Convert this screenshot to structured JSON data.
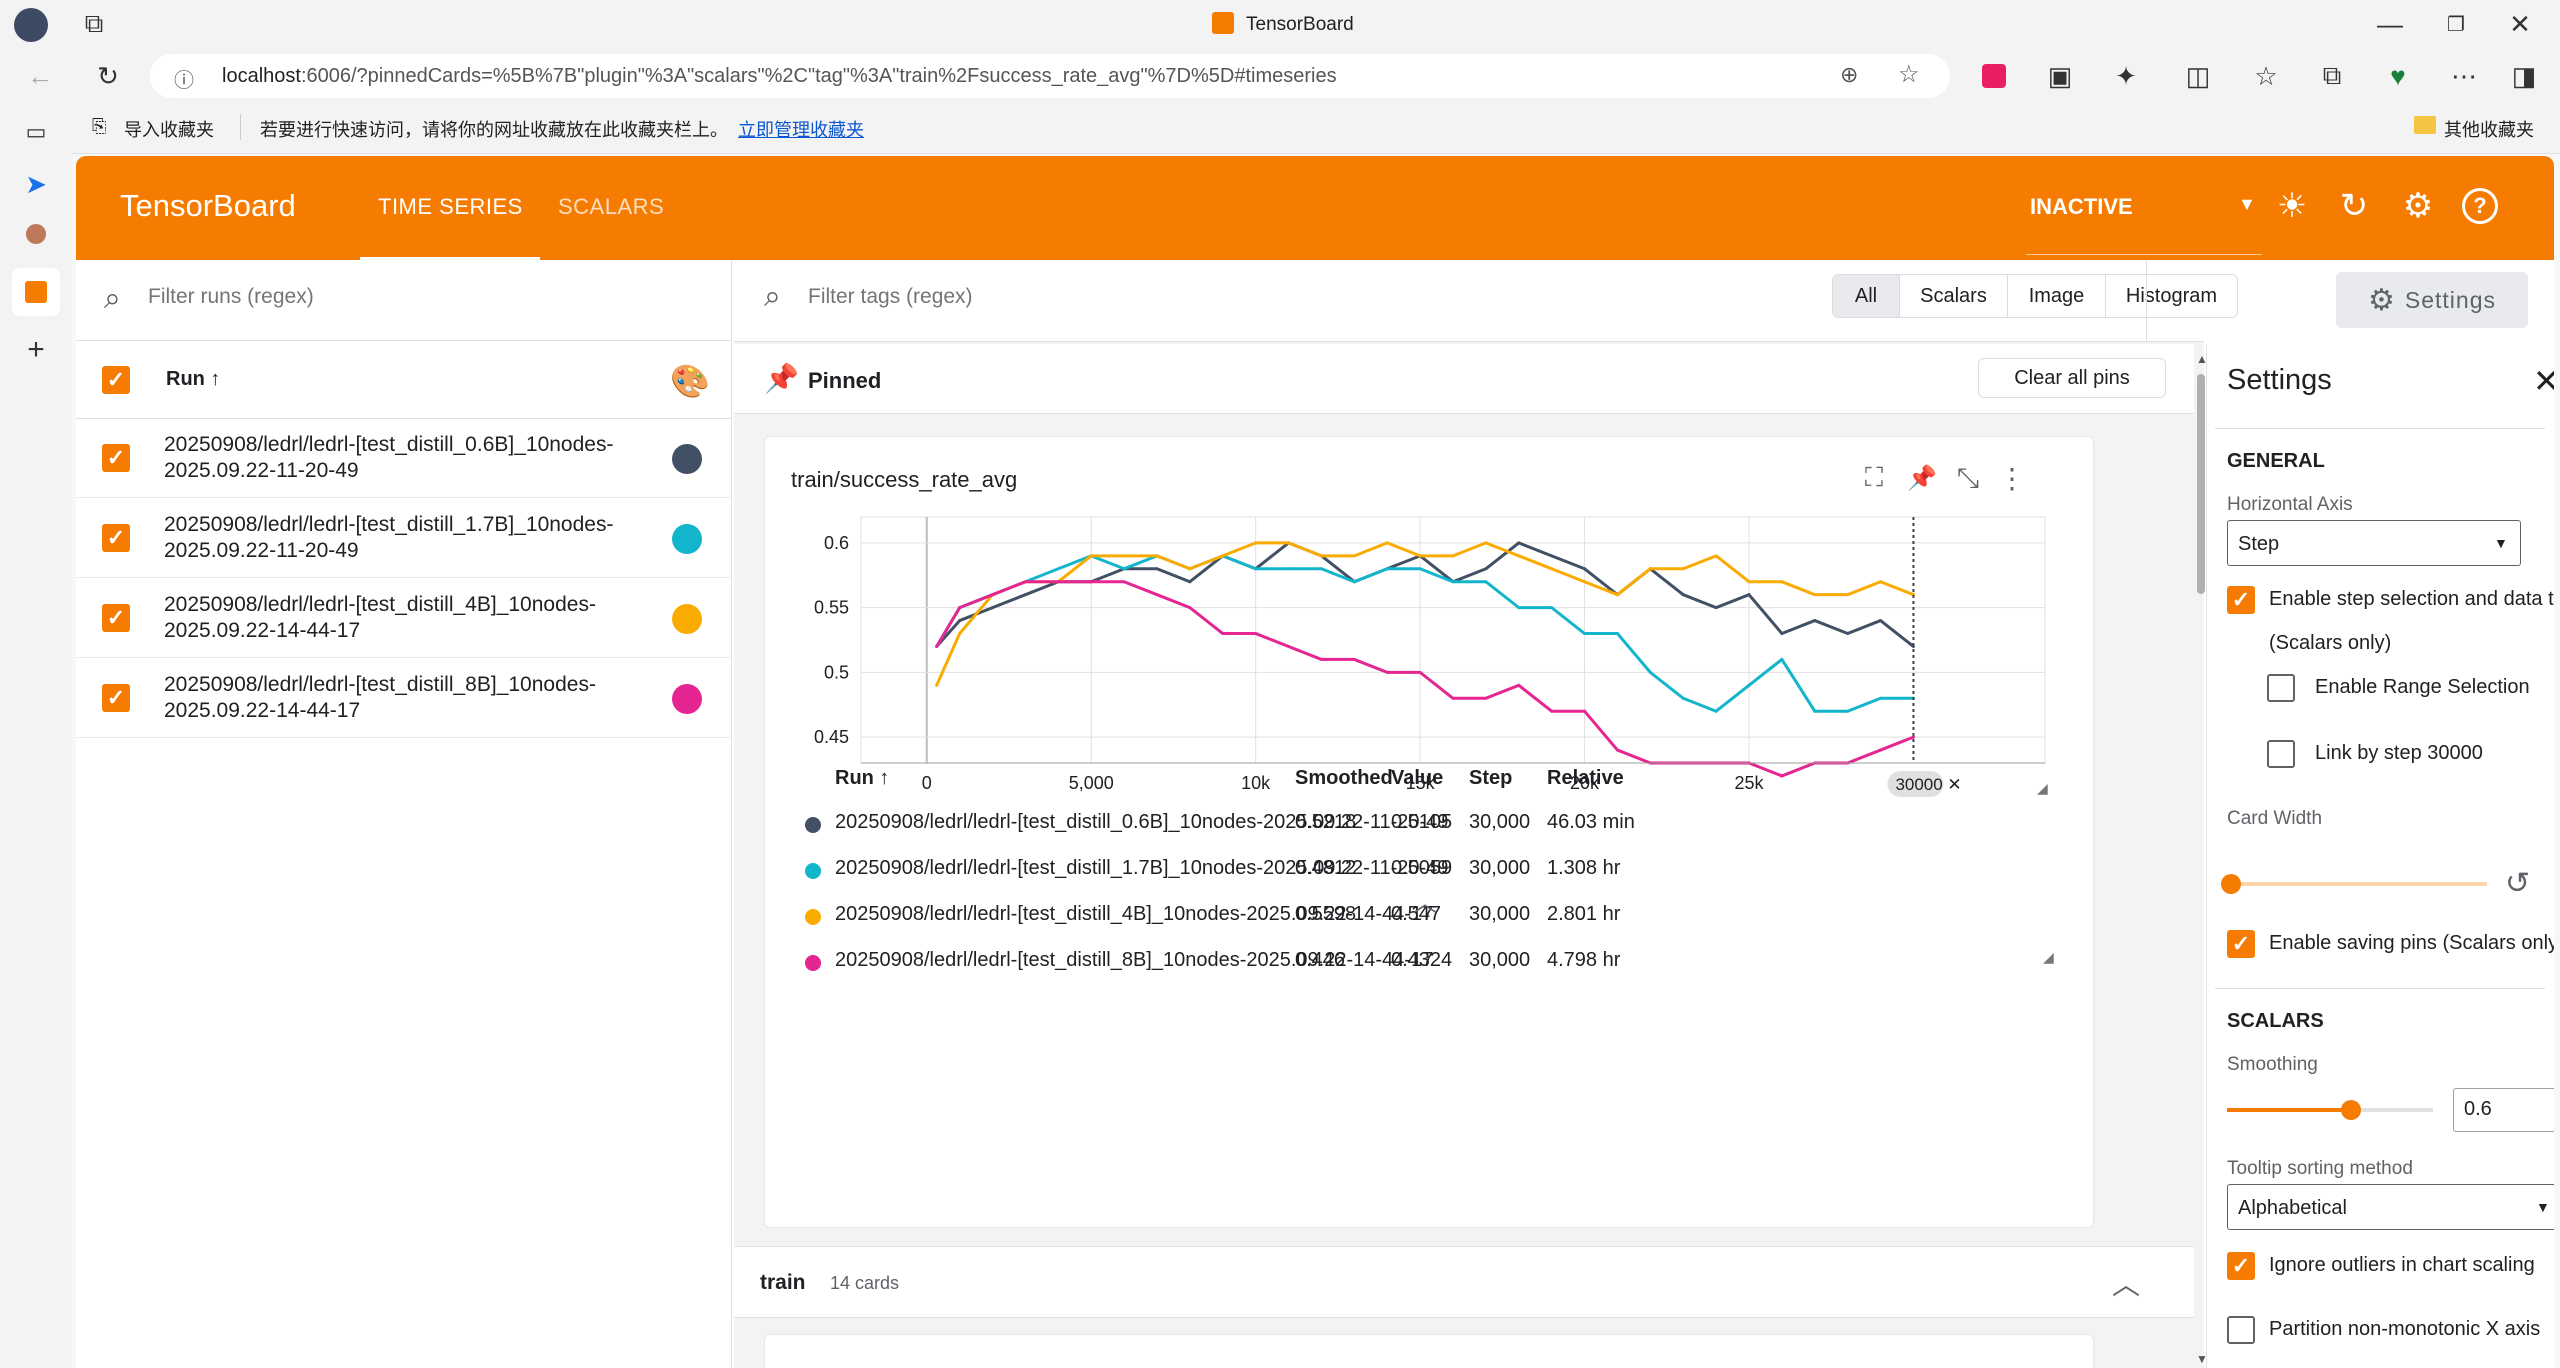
{
  "browser": {
    "tab_title": "TensorBoard",
    "url_host": "localhost",
    "url_rest": ":6006/?pinnedCards=%5B%7B\"plugin\"%3A\"scalars\"%2C\"tag\"%3A\"train%2Fsuccess_rate_avg\"%7D%5D#timeseries",
    "fav_import": "导入收藏夹",
    "fav_hint": "若要进行快速访问，请将你的网址收藏放在此收藏夹栏上。",
    "fav_manage": "立即管理收藏夹",
    "fav_other": "其他收藏夹"
  },
  "header": {
    "logo": "TensorBoard",
    "tabs": [
      "TIME SERIES",
      "SCALARS"
    ],
    "status": "INACTIVE"
  },
  "runs_panel": {
    "filter_placeholder": "Filter runs (regex)",
    "column": "Run ↑",
    "runs": [
      {
        "line1": "20250908/ledrl/ledrl-[test_distill_0.6B]_10nodes-",
        "line2": "2025.09.22-11-20-49",
        "color": "#425066"
      },
      {
        "line1": "20250908/ledrl/ledrl-[test_distill_1.7B]_10nodes-",
        "line2": "2025.09.22-11-20-49",
        "color": "#12b5cb"
      },
      {
        "line1": "20250908/ledrl/ledrl-[test_distill_4B]_10nodes-",
        "line2": "2025.09.22-14-44-17",
        "color": "#f9ab00"
      },
      {
        "line1": "20250908/ledrl/ledrl-[test_distill_8B]_10nodes-",
        "line2": "2025.09.22-14-44-17",
        "color": "#e52592"
      }
    ]
  },
  "main": {
    "filter_placeholder": "Filter tags (regex)",
    "type_buttons": [
      "All",
      "Scalars",
      "Image",
      "Histogram"
    ],
    "settings_button": "Settings",
    "pinned_label": "Pinned",
    "clear_pins": "Clear all pins",
    "card_title": "train/success_rate_avg",
    "step_marker": "30000",
    "table_headers": [
      "Run ↑",
      "Smoothed",
      "Value",
      "Step",
      "Relative"
    ],
    "table_rows": [
      {
        "run": "20250908/ledrl/ledrl-[test_distill_0.6B]_10nodes-2025.09.22-11-20-49",
        "smoothed": "0.5218",
        "value": "0.5105",
        "step": "30,000",
        "relative": "46.03 min",
        "color": "#425066"
      },
      {
        "run": "20250908/ledrl/ledrl-[test_distill_1.7B]_10nodes-2025.09.22-11-20-49",
        "smoothed": "0.4812",
        "value": "0.5059",
        "step": "30,000",
        "relative": "1.308 hr",
        "color": "#12b5cb"
      },
      {
        "run": "20250908/ledrl/ledrl-[test_distill_4B]_10nodes-2025.09.22-14-44-17",
        "smoothed": "0.5598",
        "value": "0.547",
        "step": "30,000",
        "relative": "2.801 hr",
        "color": "#f9ab00"
      },
      {
        "run": "20250908/ledrl/ledrl-[test_distill_8B]_10nodes-2025.09.22-14-44-17",
        "smoothed": "0.446",
        "value": "0.4324",
        "step": "30,000",
        "relative": "4.798 hr",
        "color": "#e52592"
      }
    ],
    "group_name": "train",
    "group_count": "14 cards"
  },
  "settings": {
    "title": "Settings",
    "general": "GENERAL",
    "horizontal_axis_label": "Horizontal Axis",
    "horizontal_axis_value": "Step",
    "enable_step": "Enable step selection and data table",
    "scalars_only": "(Scalars only)",
    "range_selection": "Enable Range Selection",
    "link_by_step": "Link by step 30000",
    "card_width": "Card Width",
    "saving_pins": "Enable saving pins (Scalars only)",
    "scalars": "SCALARS",
    "smoothing_label": "Smoothing",
    "smoothing_value": "0.6",
    "tooltip_label": "Tooltip sorting method",
    "tooltip_value": "Alphabetical",
    "ignore_outliers": "Ignore outliers in chart scaling",
    "partition": "Partition non-monotonic X axis"
  },
  "chart_data": {
    "type": "line",
    "title": "train/success_rate_avg",
    "xlabel": "",
    "ylabel": "",
    "xlim": [
      -2000,
      34000
    ],
    "ylim": [
      0.43,
      0.62
    ],
    "xticks": [
      "0",
      "5,000",
      "10k",
      "15k",
      "20k",
      "25k"
    ],
    "xtick_values": [
      0,
      5000,
      10000,
      15000,
      20000,
      25000
    ],
    "yticks": [
      "0.45",
      "0.5",
      "0.55",
      "0.6"
    ],
    "ytick_values": [
      0.45,
      0.5,
      0.55,
      0.6
    ],
    "grid": true,
    "x": [
      300,
      1000,
      2000,
      3000,
      4000,
      5000,
      6000,
      7000,
      8000,
      9000,
      10000,
      11000,
      12000,
      13000,
      14000,
      15000,
      16000,
      17000,
      18000,
      19000,
      20000,
      21000,
      22000,
      23000,
      24000,
      25000,
      26000,
      27000,
      28000,
      29000,
      30000
    ],
    "series": [
      {
        "name": "20250908/ledrl/ledrl-[test_distill_0.6B]_10nodes-2025.09.22-11-20-49",
        "color": "#425066",
        "values": [
          0.52,
          0.54,
          0.55,
          0.56,
          0.57,
          0.57,
          0.58,
          0.58,
          0.57,
          0.59,
          0.58,
          0.6,
          0.59,
          0.57,
          0.58,
          0.59,
          0.57,
          0.58,
          0.6,
          0.59,
          0.58,
          0.56,
          0.58,
          0.56,
          0.55,
          0.56,
          0.53,
          0.54,
          0.53,
          0.54,
          0.52
        ]
      },
      {
        "name": "20250908/ledrl/ledrl-[test_distill_1.7B]_10nodes-2025.09.22-11-20-49",
        "color": "#12b5cb",
        "values": [
          0.52,
          0.55,
          0.56,
          0.57,
          0.58,
          0.59,
          0.58,
          0.59,
          0.58,
          0.59,
          0.58,
          0.58,
          0.58,
          0.57,
          0.58,
          0.58,
          0.57,
          0.57,
          0.55,
          0.55,
          0.53,
          0.53,
          0.5,
          0.48,
          0.47,
          0.49,
          0.51,
          0.47,
          0.47,
          0.48,
          0.48
        ]
      },
      {
        "name": "20250908/ledrl/ledrl-[test_distill_4B]_10nodes-2025.09.22-14-44-17",
        "color": "#f9ab00",
        "values": [
          0.49,
          0.53,
          0.56,
          0.57,
          0.57,
          0.59,
          0.59,
          0.59,
          0.58,
          0.59,
          0.6,
          0.6,
          0.59,
          0.59,
          0.6,
          0.59,
          0.59,
          0.6,
          0.59,
          0.58,
          0.57,
          0.56,
          0.58,
          0.58,
          0.59,
          0.57,
          0.57,
          0.56,
          0.56,
          0.57,
          0.56
        ]
      },
      {
        "name": "20250908/ledrl/ledrl-[test_distill_8B]_10nodes-2025.09.22-14-44-17",
        "color": "#e52592",
        "values": [
          0.52,
          0.55,
          0.56,
          0.57,
          0.57,
          0.57,
          0.57,
          0.56,
          0.55,
          0.53,
          0.53,
          0.52,
          0.51,
          0.51,
          0.5,
          0.5,
          0.48,
          0.48,
          0.49,
          0.47,
          0.47,
          0.44,
          0.43,
          0.43,
          0.43,
          0.43,
          0.42,
          0.43,
          0.43,
          0.44,
          0.45
        ]
      }
    ]
  }
}
